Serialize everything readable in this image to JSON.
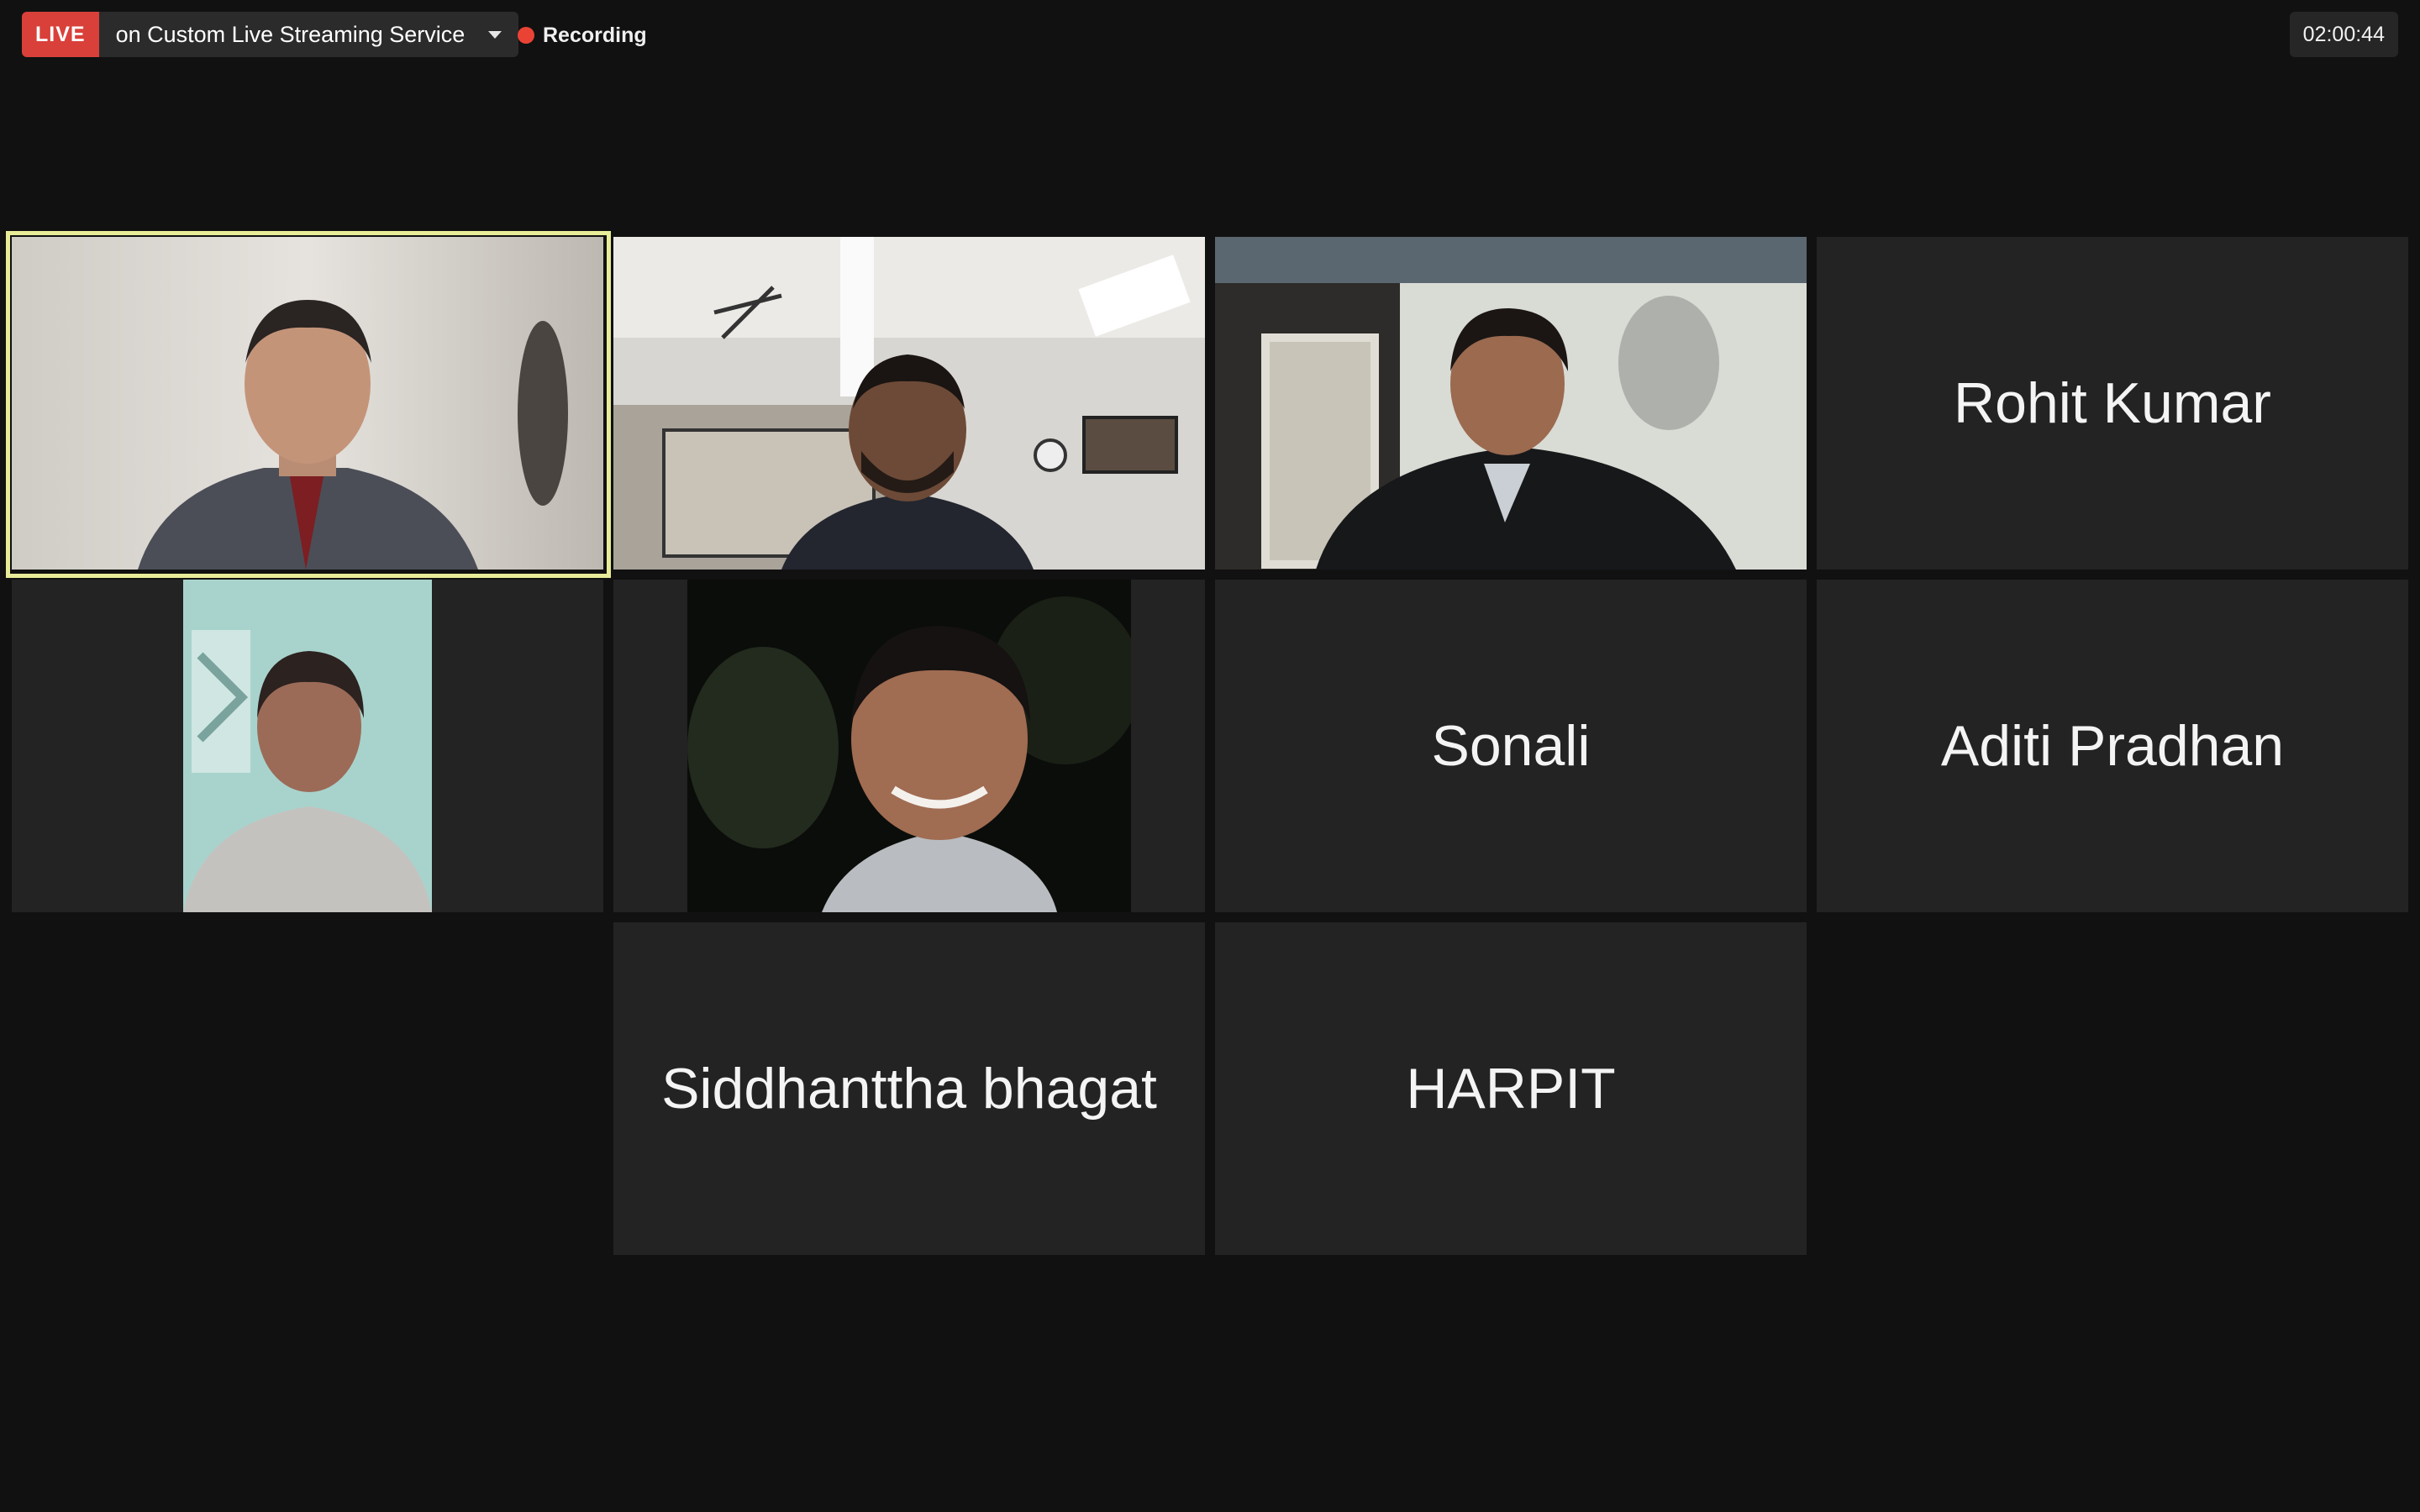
{
  "topbar": {
    "live_label": "LIVE",
    "stream_service": "on Custom Live Streaming Service",
    "recording_label": "Recording",
    "elapsed_time": "02:00:44"
  },
  "participants": [
    {
      "kind": "video",
      "label": "participant-video-1"
    },
    {
      "kind": "video",
      "label": "participant-video-2"
    },
    {
      "kind": "video",
      "label": "participant-video-3"
    },
    {
      "kind": "name",
      "name": "Rohit Kumar"
    },
    {
      "kind": "video",
      "label": "participant-video-5"
    },
    {
      "kind": "video",
      "label": "participant-video-6"
    },
    {
      "kind": "name",
      "name": "Sonali"
    },
    {
      "kind": "name",
      "name": "Aditi Pradhan"
    },
    {
      "kind": "name",
      "name": "Siddhanttha bhagat"
    },
    {
      "kind": "name",
      "name": "HARPIT"
    }
  ],
  "colors": {
    "live": "#d9403a",
    "recording_dot": "#ea4335",
    "active_speaker_border": "#e8ec98",
    "tile_bg": "#232323",
    "page_bg": "#111111"
  }
}
